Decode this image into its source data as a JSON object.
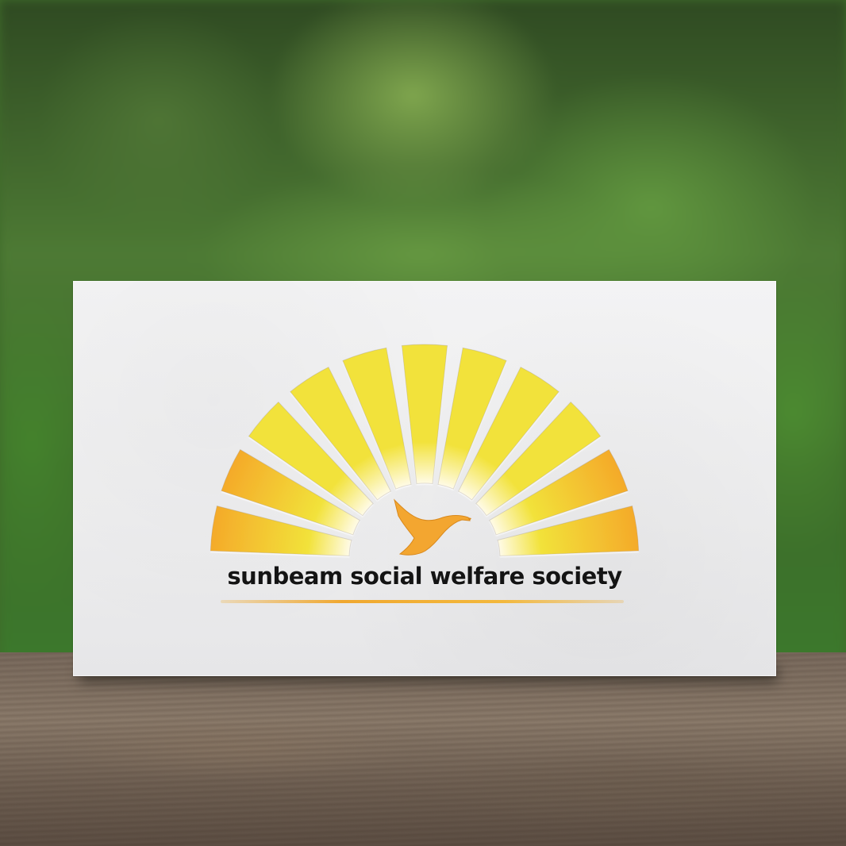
{
  "logo": {
    "organization_name": "sunbeam social welfare society",
    "emblem_icon": "sunrise-rays-icon",
    "bird_icon": "hummingbird-icon",
    "colors": {
      "ray_light": "#f2e23a",
      "ray_deep": "#f4aa2a",
      "bird": "#f3a630",
      "text": "#141414",
      "card": "#eeeeef"
    }
  },
  "scene": {
    "background": "blurred green foliage",
    "surface": "weathered wood"
  }
}
